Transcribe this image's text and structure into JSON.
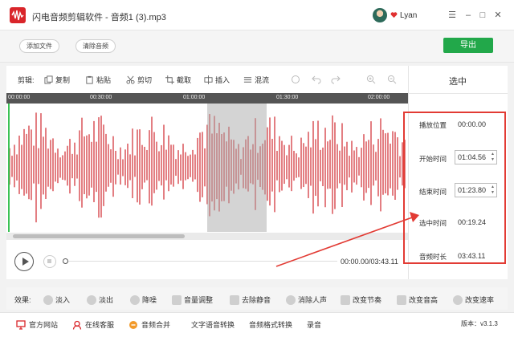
{
  "window": {
    "title": "闪电音频剪辑软件 - 音频1 (3).mp3",
    "user": "Lyan",
    "minimize": "–",
    "maximize": "□",
    "close": "✕",
    "menu": "☰"
  },
  "actions": {
    "add_file": "添加文件",
    "clear_audio": "清除音频",
    "export": "导出"
  },
  "toolbar": {
    "label": "剪辑:",
    "copy": "复制",
    "paste": "粘贴",
    "cut": "剪切",
    "crop": "截取",
    "insert": "插入",
    "mix": "混流"
  },
  "timeline": {
    "ticks": [
      "00:00:00",
      "00:30:00",
      "01:00:00",
      "01:30:00",
      "02:00:00"
    ],
    "current_time": "00:00.00/03:43.11"
  },
  "side": {
    "title": "选中",
    "play_position_label": "播放位置",
    "play_position_value": "00:00.00",
    "start_label": "开始时间",
    "start_value": "01:04.56",
    "end_label": "结束时间",
    "end_value": "01:23.80",
    "selected_label": "选中时间",
    "selected_value": "00:19.24",
    "duration_label": "音频时长",
    "duration_value": "03:43.11"
  },
  "effects": {
    "label": "效果:",
    "items": [
      "淡入",
      "淡出",
      "降噪",
      "音量调整",
      "去除静音",
      "消除人声",
      "改变节奏",
      "改变音高",
      "改变速率"
    ]
  },
  "bottom": {
    "website": "官方网站",
    "support": "在线客服",
    "merge": "音频合并",
    "tts": "文字语音转换",
    "convert": "音频格式转换",
    "record": "录音",
    "version": "版本：v3.1.3"
  },
  "colors": {
    "accent": "#22a84a",
    "waveform": "#d0282e",
    "highlight": "#e23b34"
  }
}
